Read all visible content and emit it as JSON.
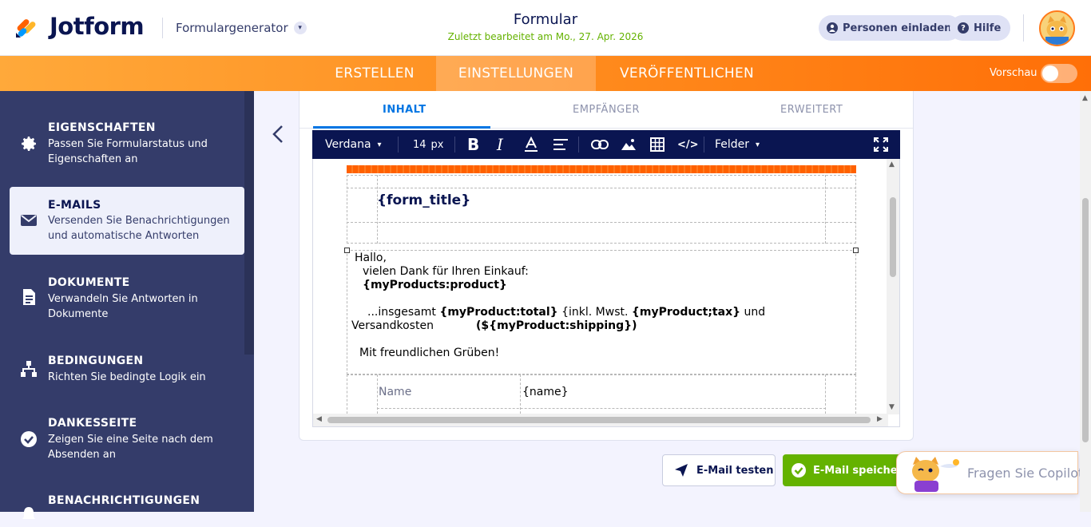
{
  "header": {
    "logo_text": "Jotform",
    "form_generator": "Formulargenerator",
    "form_title": "Formular",
    "last_edited": "Zuletzt bearbeitet am Mo., 27. Apr. 2026",
    "invite_label": "Personen einladen",
    "help_label": "Hilfe"
  },
  "tabs": {
    "create": "ERSTELLEN",
    "settings": "EINSTELLUNGEN",
    "publish": "VERÖFFENTLICHEN",
    "preview": "Vorschau"
  },
  "sidebar": {
    "items": [
      {
        "title": "EIGENSCHAFTEN",
        "desc": "Passen Sie Formularstatus und Eigenschaften an",
        "icon": "gear-icon"
      },
      {
        "title": "E-MAILS",
        "desc": "Versenden Sie Benachrichtigungen und automatische Antworten",
        "icon": "envelope-icon"
      },
      {
        "title": "DOKUMENTE",
        "desc": "Verwandeln Sie Antworten in Dokumente",
        "icon": "document-icon"
      },
      {
        "title": "BEDINGUNGEN",
        "desc": "Richten Sie bedingte Logik ein",
        "icon": "sitemap-icon"
      },
      {
        "title": "DANKESSEITE",
        "desc": "Zeigen Sie eine Seite nach dem Absenden an",
        "icon": "check-circle-icon"
      },
      {
        "title": "BENACHRICHTIGUNGEN",
        "desc": "",
        "icon": "bell-icon"
      }
    ]
  },
  "email_tabs": {
    "content": "INHALT",
    "recipients": "EMPFÄNGER",
    "advanced": "ERWEITERT"
  },
  "toolbar": {
    "font": "Verdana",
    "size": "14",
    "unit": "px",
    "fields": "Felder"
  },
  "email_body": {
    "title_tag": "{form_title}",
    "greeting": "Hallo,",
    "thanks": "vielen Dank für Ihren Einkauf:",
    "product_tag": "{myProducts:product}",
    "total_prefix": "...insgesamt",
    "total_tag": "{myProduct:total}",
    "incl": "{inkl. Mwst.",
    "tax_tag": "{myProduct;tax}",
    "and": "und",
    "shipping_label": "Versandkosten",
    "shipping_tag": "(${myProduct:shipping})",
    "closing": "Mit freundlichen Grüben!",
    "row_label": "Name",
    "row_value": "{name}"
  },
  "buttons": {
    "test_email": "E-Mail testen",
    "save_email": "E-Mail speichern"
  },
  "copilot": {
    "label": "Fragen Sie Copilot"
  },
  "colors": {
    "navy": "#0a1551",
    "orange": "#ff6100",
    "green": "#64b200",
    "blue": "#0075e3",
    "sidebar": "#343c6a"
  }
}
